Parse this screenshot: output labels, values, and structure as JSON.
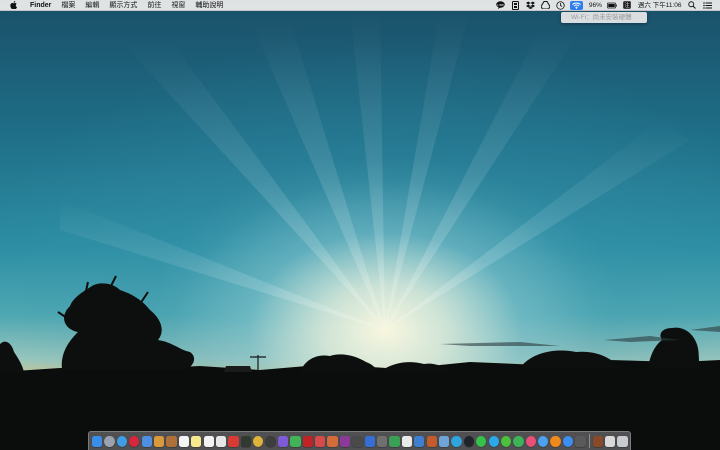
{
  "menubar": {
    "app_name": "Finder",
    "menus": [
      "檔案",
      "編輯",
      "顯示方式",
      "前往",
      "視窗",
      "輔助說明"
    ],
    "battery_percent": "96%",
    "datetime": "週六 下午11:06"
  },
  "wifi_menu": {
    "status": "Wi-Fi：尚未安裝硬體"
  },
  "status_icons": [
    "line-icon",
    "memory-icon",
    "dropbox-icon",
    "google-drive-icon",
    "time-machine-icon",
    "wifi-icon",
    "battery-icon",
    "input-source-icon",
    "spotlight-icon",
    "notification-center-icon"
  ],
  "dock": {
    "apps": [
      {
        "name": "finder-icon",
        "color": "#3b8ee8"
      },
      {
        "name": "launchpad-icon",
        "color": "#9aa3ad"
      },
      {
        "name": "safari-icon",
        "color": "#3f9de6"
      },
      {
        "name": "opera-icon",
        "color": "#d7263d"
      },
      {
        "name": "preview-icon",
        "color": "#4f8ee0"
      },
      {
        "name": "archive-icon",
        "color": "#d99a3c"
      },
      {
        "name": "notebook-icon",
        "color": "#b0703a"
      },
      {
        "name": "calendar-icon",
        "color": "#f4f4f4"
      },
      {
        "name": "notes-icon",
        "color": "#f7e98e"
      },
      {
        "name": "reminders-icon",
        "color": "#f2f2f2"
      },
      {
        "name": "photos-viewer-icon",
        "color": "#e6e6e6"
      },
      {
        "name": "pdf-icon",
        "color": "#d83b34"
      },
      {
        "name": "terminal-icon",
        "color": "#303a30"
      },
      {
        "name": "chrome-icon",
        "color": "#e0b43a"
      },
      {
        "name": "camera-icon",
        "color": "#3d3d3d"
      },
      {
        "name": "imovie-icon",
        "color": "#7d5bd6"
      },
      {
        "name": "evernote-icon",
        "color": "#42b356"
      },
      {
        "name": "flash-icon",
        "color": "#c02226"
      },
      {
        "name": "app-red-icon",
        "color": "#d84a4a"
      },
      {
        "name": "airmail-icon",
        "color": "#d46b3a"
      },
      {
        "name": "stocks-icon",
        "color": "#8b3a9a"
      },
      {
        "name": "audio-icon",
        "color": "#4a4a4a"
      },
      {
        "name": "system-tool-icon",
        "color": "#356fd6"
      },
      {
        "name": "utility-icon",
        "color": "#707070"
      },
      {
        "name": "activity-monitor-icon",
        "color": "#3aa055"
      },
      {
        "name": "font-book-icon",
        "color": "#eaeaea"
      },
      {
        "name": "file-icon",
        "color": "#3f7fd0"
      },
      {
        "name": "photo-booth-icon",
        "color": "#c45b2a"
      },
      {
        "name": "map-icon",
        "color": "#6fa4d8"
      },
      {
        "name": "skype-cloud-icon",
        "color": "#2fa4de"
      },
      {
        "name": "dark-app-icon",
        "color": "#20232a"
      },
      {
        "name": "line-app-icon",
        "color": "#34c24a"
      },
      {
        "name": "skype-icon",
        "color": "#2aa8e8"
      },
      {
        "name": "wechat-icon",
        "color": "#4cc03a"
      },
      {
        "name": "facetime-icon",
        "color": "#3bb45a"
      },
      {
        "name": "itunes-icon",
        "color": "#e8507a"
      },
      {
        "name": "messages-icon",
        "color": "#4ca2ee"
      },
      {
        "name": "vlc-icon",
        "color": "#ee8a1c"
      },
      {
        "name": "app-store-icon",
        "color": "#3c8ff0"
      },
      {
        "name": "screenshot-icon",
        "color": "#5a5a5a"
      }
    ],
    "right": [
      {
        "name": "books-icon",
        "color": "#8a4a2a"
      },
      {
        "name": "downloads-icon",
        "color": "#d9d9d9"
      },
      {
        "name": "trash-icon",
        "color": "#c8ccd0"
      }
    ]
  }
}
